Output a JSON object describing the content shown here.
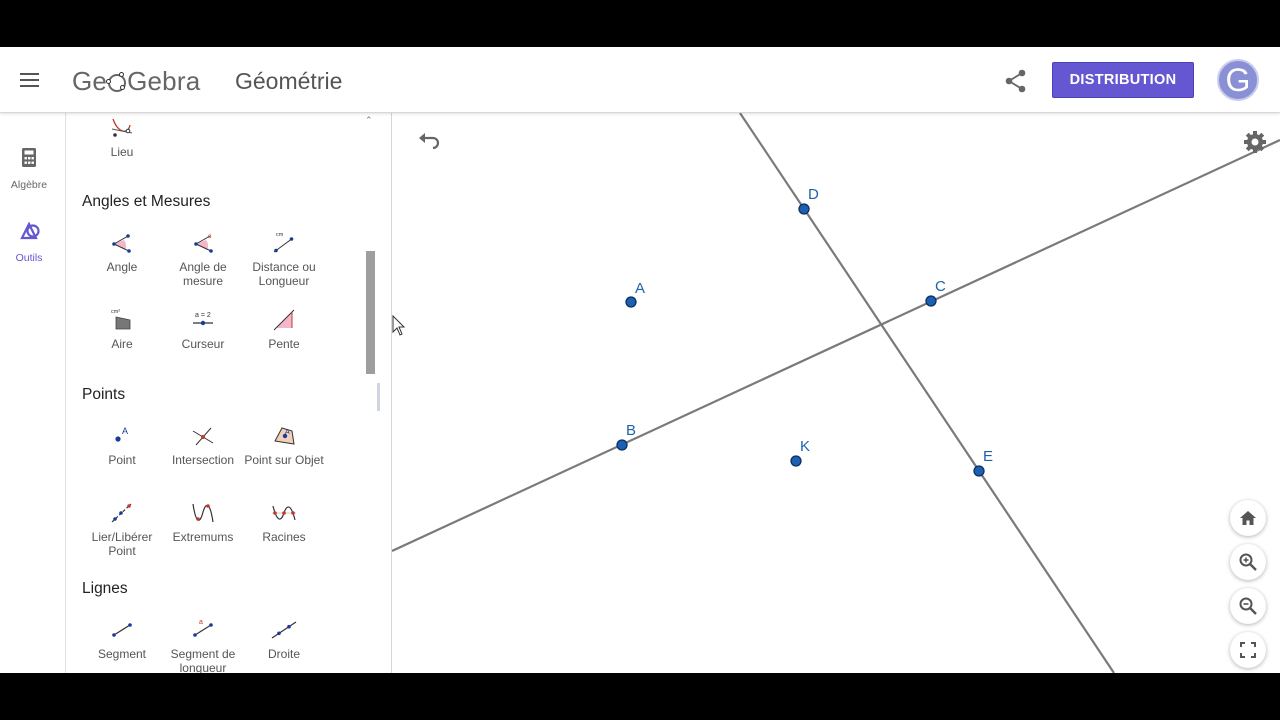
{
  "header": {
    "logo_text": "GeoGebra",
    "app_title": "Géométrie",
    "distribution_label": "DISTRIBUTION",
    "avatar_letter": "G"
  },
  "rail": {
    "items": [
      {
        "label": "Algèbre",
        "icon": "calculator-icon"
      },
      {
        "label": "Outils",
        "icon": "tools-icon",
        "active": true
      }
    ]
  },
  "tools": {
    "partial_top": {
      "label": "Lieu",
      "icon": "locus-icon"
    },
    "sections": [
      {
        "title": "Angles et Mesures",
        "items": [
          {
            "label": "Angle",
            "icon": "angle-icon"
          },
          {
            "label": "Angle de mesure",
            "icon": "angle-fixed-icon"
          },
          {
            "label": "Distance ou Longueur",
            "icon": "distance-icon"
          },
          {
            "label": "Aire",
            "icon": "area-icon"
          },
          {
            "label": "Curseur",
            "icon": "slider-icon"
          },
          {
            "label": "Pente",
            "icon": "slope-icon"
          }
        ]
      },
      {
        "title": "Points",
        "items": [
          {
            "label": "Point",
            "icon": "point-icon"
          },
          {
            "label": "Intersection",
            "icon": "intersection-icon"
          },
          {
            "label": "Point sur Objet",
            "icon": "point-on-object-icon"
          },
          {
            "label": "Lier/Libérer Point",
            "icon": "attach-detach-icon"
          },
          {
            "label": "Extremums",
            "icon": "extremum-icon"
          },
          {
            "label": "Racines",
            "icon": "roots-icon"
          }
        ]
      },
      {
        "title": "Lignes",
        "items": [
          {
            "label": "Segment",
            "icon": "segment-icon"
          },
          {
            "label": "Segment de longueur",
            "icon": "segment-fixed-icon"
          },
          {
            "label": "Droite",
            "icon": "line-icon"
          }
        ]
      }
    ]
  },
  "graphics": {
    "points": [
      "A",
      "B",
      "C",
      "D",
      "E",
      "K"
    ],
    "icons": [
      "undo-icon",
      "settings-icon",
      "home-icon",
      "zoom-in-icon",
      "zoom-out-icon",
      "fullscreen-icon"
    ],
    "colors": {
      "point": "#1e63a8",
      "line": "#7a7a7a",
      "accent": "#6557d2"
    }
  }
}
